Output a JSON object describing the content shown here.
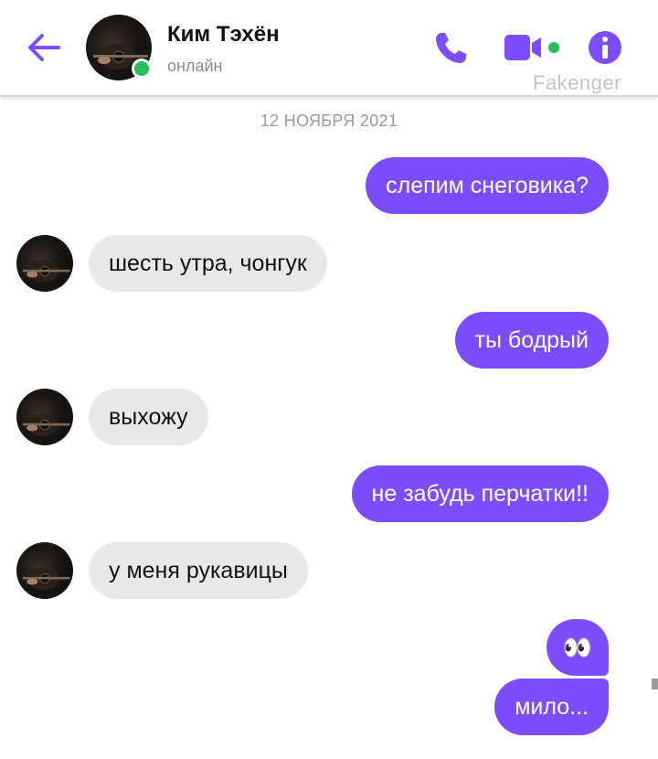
{
  "header": {
    "contact_name": "Ким Тэхён",
    "status": "онлайн",
    "watermark": "Fakenger",
    "icons": [
      "back-arrow-icon",
      "phone-icon",
      "video-camera-icon",
      "info-icon"
    ]
  },
  "colors": {
    "accent": "#7c4dff",
    "incoming_bubble": "#e8e8e8",
    "online": "#25c05a"
  },
  "chat": {
    "date_divider": "12 НОЯБРЯ 2021",
    "messages": [
      {
        "side": "out",
        "text": "слепим снеговика?"
      },
      {
        "side": "in",
        "text": "шесть утра, чонгук"
      },
      {
        "side": "out",
        "text": "ты бодрый"
      },
      {
        "side": "in",
        "text": "выхожу"
      },
      {
        "side": "out",
        "text": "не забудь перчатки!!"
      },
      {
        "side": "in",
        "text": "у меня рукавицы"
      },
      {
        "side": "out",
        "text": "👀"
      },
      {
        "side": "out",
        "text": "мило..."
      }
    ]
  }
}
